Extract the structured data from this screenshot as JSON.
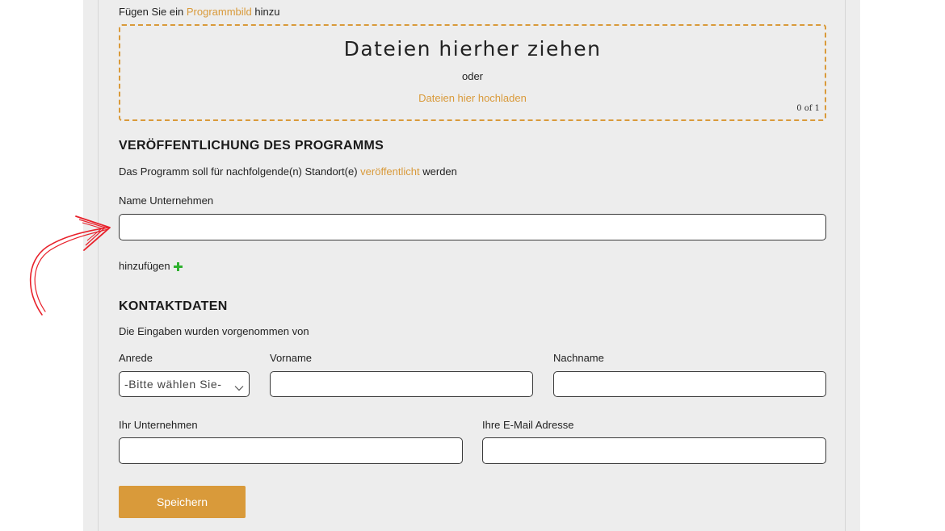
{
  "image_section": {
    "prompt_prefix": "Fügen Sie ein",
    "prompt_link": "Programmbild",
    "prompt_suffix": "hinzu",
    "drop_title": "Dateien hierher ziehen",
    "drop_or": "oder",
    "upload_link": "Dateien hier hochladen",
    "file_counter": "0 of 1"
  },
  "publication": {
    "heading": "VERÖFFENTLICHUNG DES PROGRAMMS",
    "description_prefix": "Das Programm soll für nachfolgende(n) Standort(e)",
    "description_link": "veröffentlicht",
    "description_suffix": "werden",
    "company_label": "Name Unternehmen",
    "company_value": "",
    "add_label": "hinzufügen"
  },
  "contact": {
    "heading": "KONTAKTDATEN",
    "description": "Die Eingaben wurden vorgenommen von",
    "salutation_label": "Anrede",
    "salutation_value": "-Bitte wählen Sie-",
    "firstname_label": "Vorname",
    "lastname_label": "Nachname",
    "company_label": "Ihr Unternehmen",
    "email_label": "Ihre E-Mail Adresse"
  },
  "actions": {
    "save_label": "Speichern"
  },
  "colors": {
    "accent": "#d99a3a",
    "plus": "#2fb12f",
    "annotation_arrow": "#e8202a"
  }
}
